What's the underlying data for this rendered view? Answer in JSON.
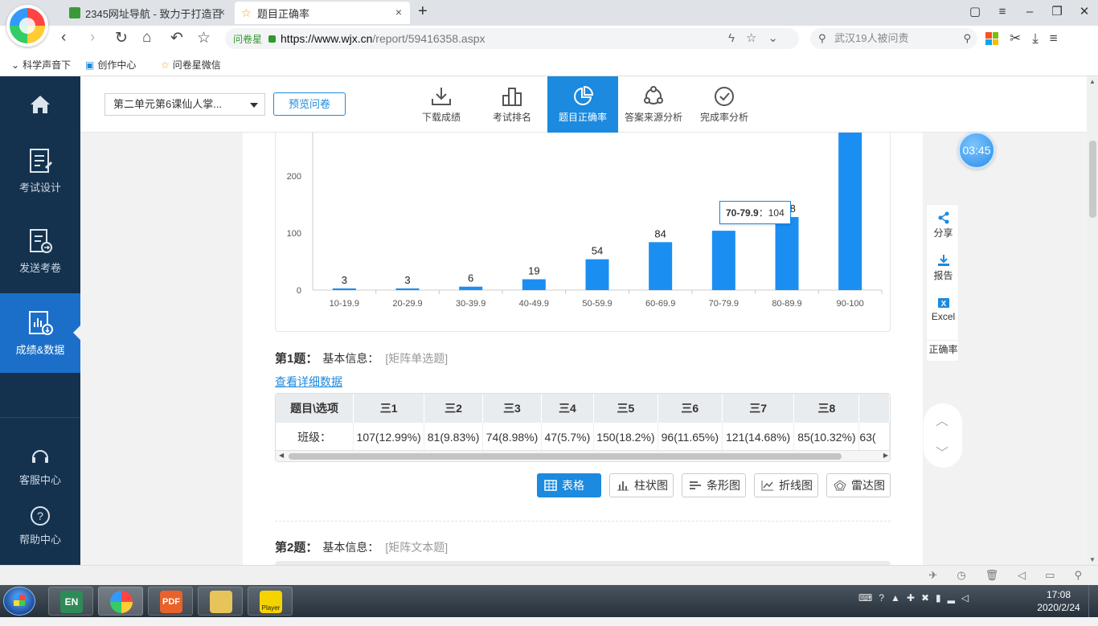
{
  "browser": {
    "tabs": [
      {
        "label": "2345网址导航 - 致力于打造百"
      },
      {
        "label": "题目正确率"
      }
    ],
    "address": {
      "badge": "问卷星",
      "host": "https://www.wjx.cn",
      "path": "/report/59416358.aspx"
    },
    "search_placeholder": "武汉19人被问责",
    "bookmarks": [
      {
        "label": "科学声音下",
        "icon": "chevron-down-icon"
      },
      {
        "label": "创作中心",
        "icon": "tv-icon"
      },
      {
        "label": "问卷星微信",
        "icon": "star-icon"
      }
    ]
  },
  "sidebar": {
    "items": [
      {
        "label": "",
        "icon": "home-icon"
      },
      {
        "label": "考试设计",
        "icon": "document-edit-icon"
      },
      {
        "label": "发送考卷",
        "icon": "document-send-icon"
      },
      {
        "label": "成绩&数据",
        "icon": "chart-download-icon",
        "active": true
      },
      {
        "label": "客服中心",
        "icon": "headset-icon"
      },
      {
        "label": "帮助中心",
        "icon": "question-icon"
      }
    ]
  },
  "toolbar": {
    "survey_select": "第二单元第6课仙人掌...",
    "preview_label": "预览问卷",
    "items": [
      {
        "label": "下载成绩",
        "icon": "download-icon"
      },
      {
        "label": "考试排名",
        "icon": "ranking-icon"
      },
      {
        "label": "题目正确率",
        "icon": "pie-chart-icon",
        "active": true
      },
      {
        "label": "答案来源分析",
        "icon": "source-icon"
      },
      {
        "label": "完成率分析",
        "icon": "check-circle-icon"
      }
    ]
  },
  "chart_data": {
    "type": "bar",
    "categories": [
      "10-19.9",
      "20-29.9",
      "30-39.9",
      "40-49.9",
      "50-59.9",
      "60-69.9",
      "70-79.9",
      "80-89.9",
      "90-100"
    ],
    "values": [
      3,
      3,
      6,
      19,
      54,
      84,
      104,
      128,
      290
    ],
    "data_labels": [
      "3",
      "3",
      "6",
      "19",
      "54",
      "84",
      "",
      "128",
      ""
    ],
    "y_ticks": [
      "0",
      "100",
      "200"
    ],
    "ylim": [
      0,
      290
    ],
    "color": "#1b8ef2",
    "tooltip": {
      "category": "70-79.9",
      "separator": "：",
      "value": "104"
    }
  },
  "q1": {
    "title": "第1题：",
    "info_label": "基本信息：",
    "type": "[矩阵单选题]",
    "detail_link": "查看详细数据",
    "table": {
      "headers": [
        "题目\\选项",
        "三1",
        "三2",
        "三3",
        "三4",
        "三5",
        "三6",
        "三7",
        "三8",
        ""
      ],
      "row": [
        "班级：",
        "107(12.99%)",
        "81(9.83%)",
        "74(8.98%)",
        "47(5.7%)",
        "150(18.2%)",
        "96(11.65%)",
        "121(14.68%)",
        "85(10.32%)",
        "63("
      ]
    }
  },
  "view_buttons": [
    {
      "label": "表格",
      "icon": "table-icon",
      "active": true
    },
    {
      "label": "柱状图",
      "icon": "bar-chart-icon"
    },
    {
      "label": "条形图",
      "icon": "hbar-chart-icon"
    },
    {
      "label": "折线图",
      "icon": "line-chart-icon"
    },
    {
      "label": "雷达图",
      "icon": "radar-chart-icon"
    }
  ],
  "q2": {
    "title": "第2题：",
    "info_label": "基本信息：",
    "type": "[矩阵文本题]"
  },
  "float": {
    "timer": "03:45",
    "tools": [
      {
        "label": "分享",
        "icon": "share-icon"
      },
      {
        "label": "报告",
        "icon": "download-icon"
      },
      {
        "label": "Excel",
        "icon": "excel-icon"
      },
      {
        "label": "正确率",
        "icon": ""
      }
    ]
  },
  "taskbar": {
    "apps": [
      "EN",
      "browser",
      "PDF",
      "folder",
      "Player"
    ],
    "time": "17:08",
    "date": "2020/2/24"
  }
}
